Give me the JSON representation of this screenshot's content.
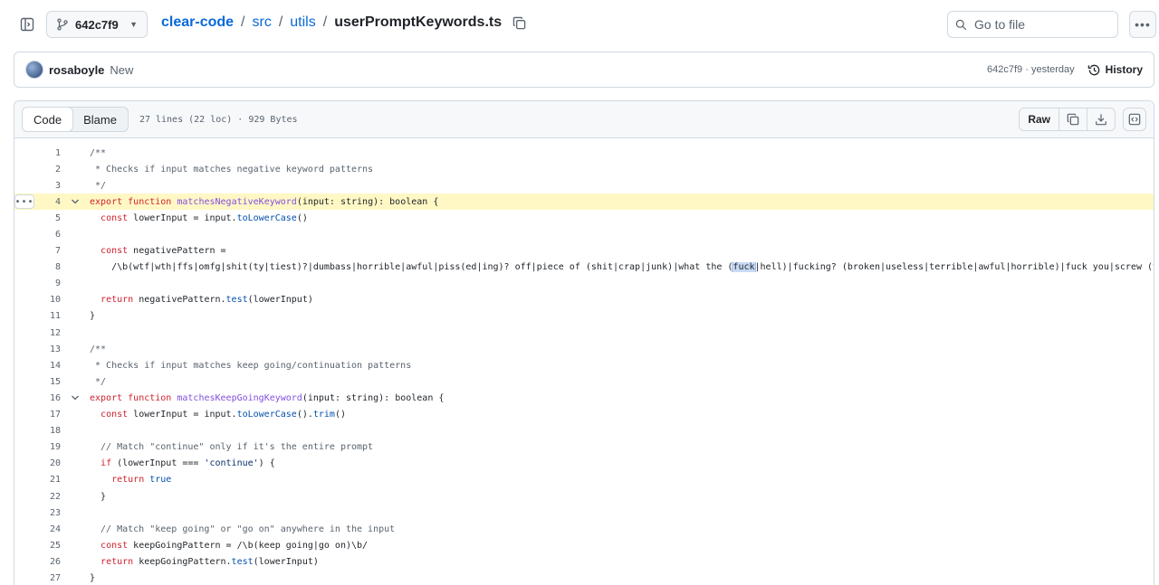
{
  "header": {
    "branch": "642c7f9",
    "breadcrumb": {
      "repo": "clear-code",
      "dir1": "src",
      "dir2": "utils",
      "separator": "/",
      "filename": "userPromptKeywords.ts"
    },
    "goto_placeholder": "Go to file"
  },
  "commit": {
    "author": "rosaboyle",
    "message": "New",
    "meta": "642c7f9 · yesterday",
    "history_label": "History"
  },
  "file": {
    "tabs": [
      {
        "label": "Code",
        "active": true
      },
      {
        "label": "Blame",
        "active": false
      }
    ],
    "info": "27 lines (22 loc) · 929 Bytes",
    "raw_label": "Raw",
    "lines": [
      {
        "n": "1",
        "text": "/**"
      },
      {
        "n": "2",
        "text": " * Checks if input matches negative keyword patterns"
      },
      {
        "n": "3",
        "text": " */"
      },
      {
        "n": "4",
        "text": "export function matchesNegativeKeyword(input: string): boolean {"
      },
      {
        "n": "5",
        "text": "  const lowerInput = input.toLowerCase()"
      },
      {
        "n": "6",
        "text": ""
      },
      {
        "n": "7",
        "text": "  const negativePattern ="
      },
      {
        "n": "8",
        "text": "    /\\b(wtf|wth|ffs|omfg|shit(ty|tiest)?|dumbass|horrible|awful|piss(ed|ing)? off|piece of (shit|crap|junk)|what the (fuck|hell)|fucking? (broken|useless|terrible|awful|horrible)|fuck you|screw (th"
      },
      {
        "n": "9",
        "text": ""
      },
      {
        "n": "10",
        "text": "  return negativePattern.test(lowerInput)"
      },
      {
        "n": "11",
        "text": "}"
      },
      {
        "n": "12",
        "text": ""
      },
      {
        "n": "13",
        "text": "/**"
      },
      {
        "n": "14",
        "text": " * Checks if input matches keep going/continuation patterns"
      },
      {
        "n": "15",
        "text": " */"
      },
      {
        "n": "16",
        "text": "export function matchesKeepGoingKeyword(input: string): boolean {"
      },
      {
        "n": "17",
        "text": "  const lowerInput = input.toLowerCase().trim()"
      },
      {
        "n": "18",
        "text": ""
      },
      {
        "n": "19",
        "text": "  // Match \"continue\" only if it's the entire prompt"
      },
      {
        "n": "20",
        "text": "  if (lowerInput === 'continue') {"
      },
      {
        "n": "21",
        "text": "    return true"
      },
      {
        "n": "22",
        "text": "  }"
      },
      {
        "n": "23",
        "text": ""
      },
      {
        "n": "24",
        "text": "  // Match \"keep going\" or \"go on\" anywhere in the input"
      },
      {
        "n": "25",
        "text": "  const keepGoingPattern = /\\b(keep going|go on)\\b/"
      },
      {
        "n": "26",
        "text": "  return keepGoingPattern.test(lowerInput)"
      },
      {
        "n": "27",
        "text": "}"
      }
    ],
    "highlighted_line": "4",
    "selected_text": "fuck"
  },
  "icons": {
    "sidebar": "sidebar-expand-icon",
    "branch": "git-branch-icon",
    "copy": "copy-icon",
    "search": "search-icon",
    "kebab": "kebab-horizontal-icon",
    "history": "history-clock-icon",
    "download": "download-icon",
    "symbols": "code-symbols-icon",
    "fold": "chevron-down-icon"
  },
  "colors": {
    "link": "#0969da",
    "highlight_line": "#fff8c5",
    "keyword": "#cf222e",
    "function": "#8250df",
    "method": "#0550ae",
    "comment": "#59636e"
  }
}
